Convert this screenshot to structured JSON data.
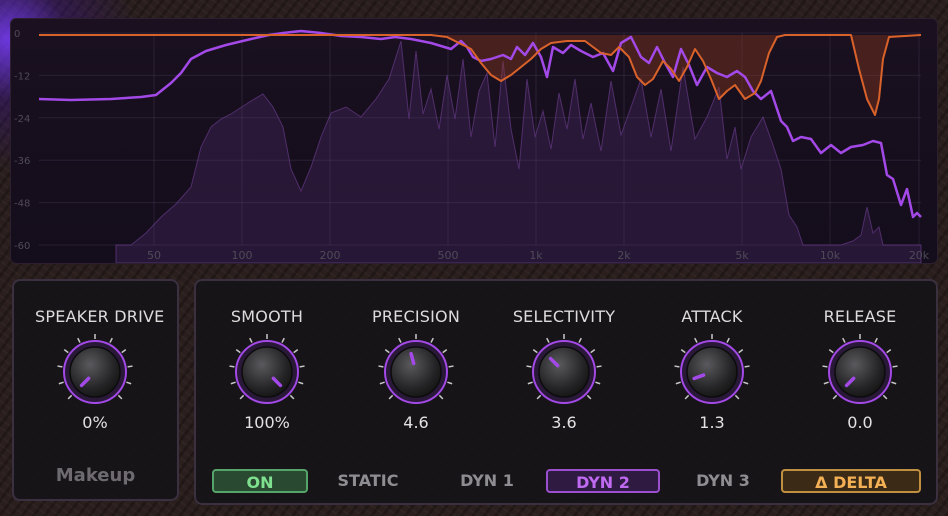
{
  "analyzer": {
    "db_ticks": [
      "0",
      "-12",
      "-24",
      "-36",
      "-48",
      "-60"
    ],
    "freq_ticks": [
      "50",
      "100",
      "200",
      "500",
      "1k",
      "2k",
      "5k",
      "10k",
      "20k"
    ]
  },
  "speaker": {
    "label": "SPEAKER DRIVE",
    "value": "0%",
    "knob_angle": 225,
    "makeup_label": "Makeup"
  },
  "knobs": [
    {
      "label": "SMOOTH",
      "value": "100%",
      "angle": 135
    },
    {
      "label": "PRECISION",
      "value": "4.6",
      "angle": 345
    },
    {
      "label": "SELECTIVITY",
      "value": "3.6",
      "angle": 315
    },
    {
      "label": "ATTACK",
      "value": "1.3",
      "angle": 250
    },
    {
      "label": "RELEASE",
      "value": "0.0",
      "angle": 225
    }
  ],
  "modes": {
    "on": "ON",
    "static": "STATIC",
    "dyn1": "DYN 1",
    "dyn2": "DYN 2",
    "dyn3": "DYN 3",
    "delta": "Δ DELTA"
  },
  "colors": {
    "accent": "#a349e8",
    "curve_orange": "#d9622b",
    "on_green": "#7fe08f",
    "delta_orange": "#f4b055"
  }
}
